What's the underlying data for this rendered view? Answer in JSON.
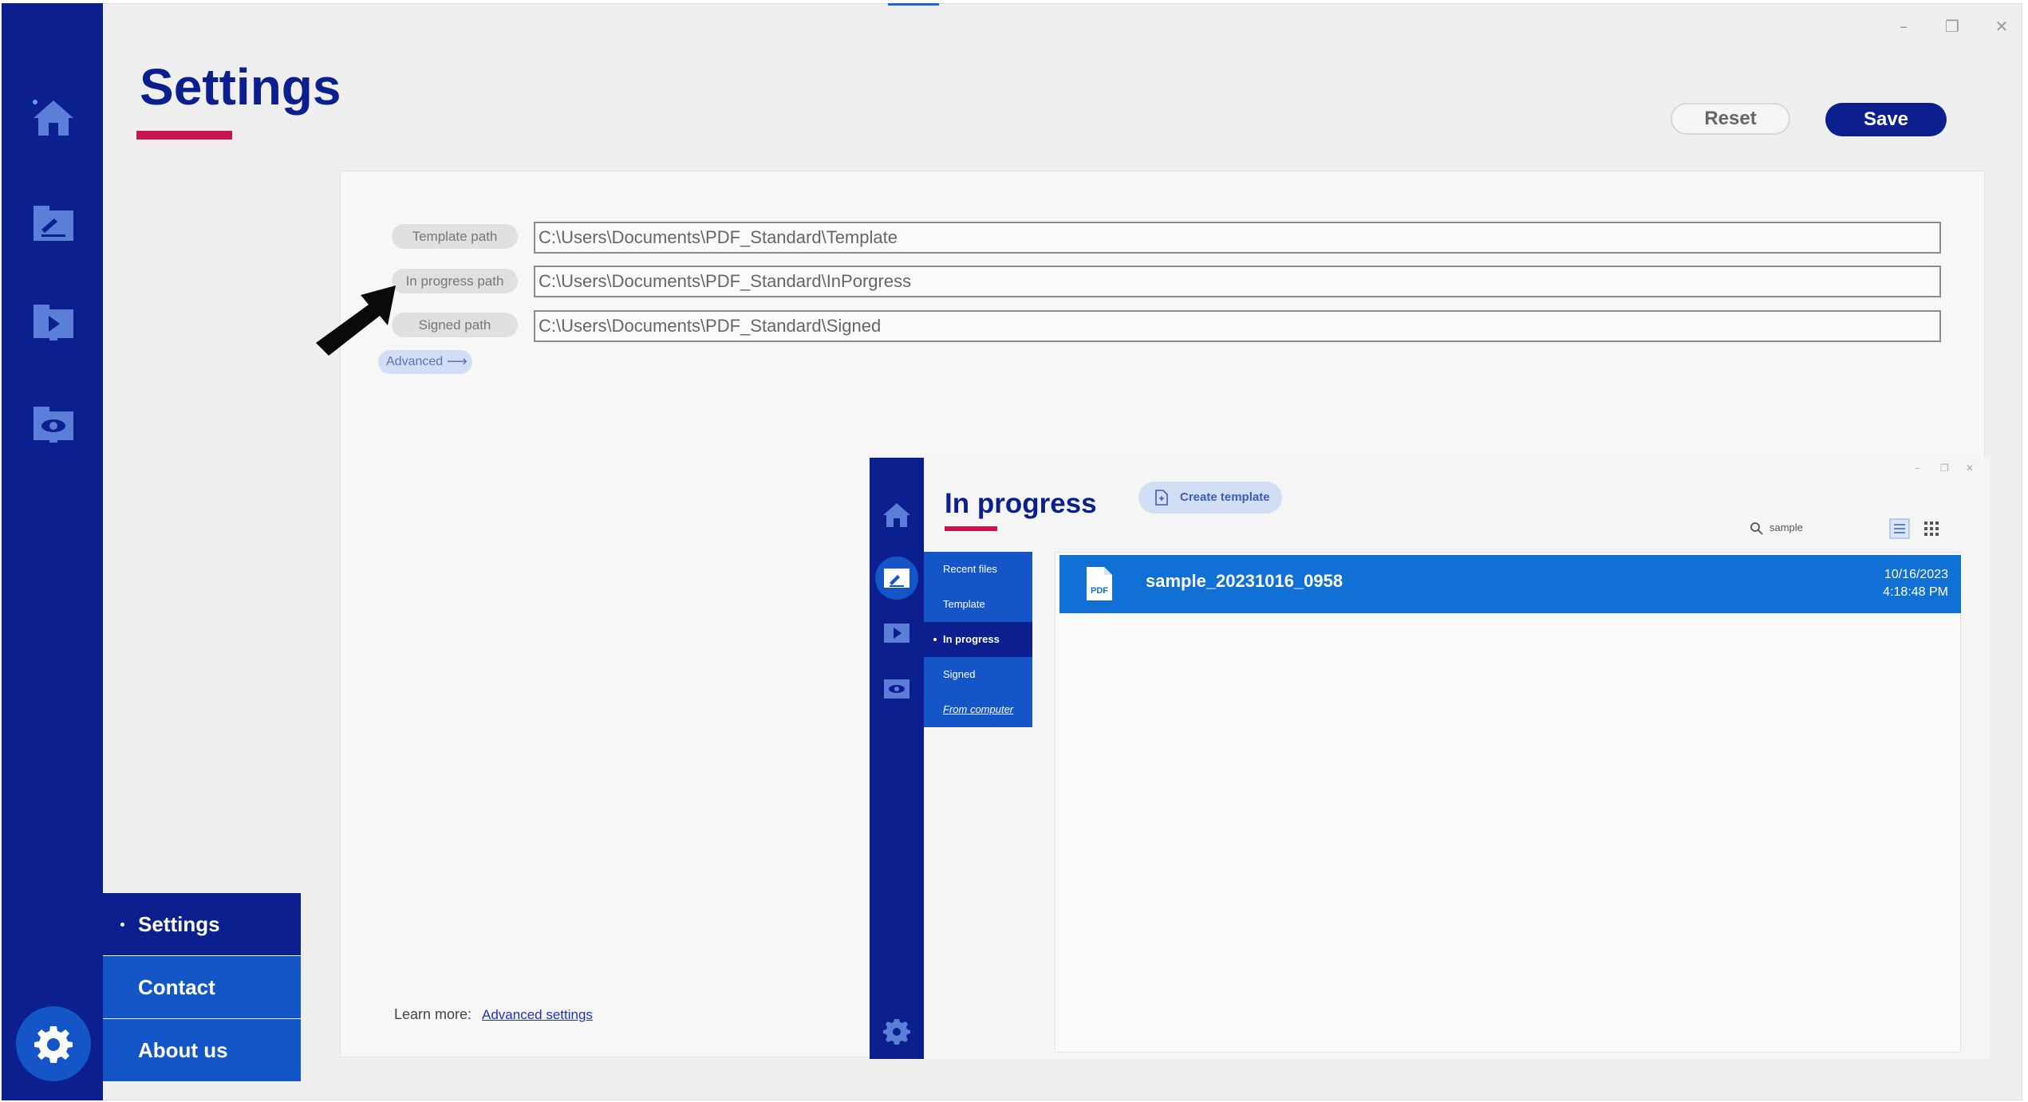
{
  "window": {
    "controls": [
      "–",
      "❐",
      "✕"
    ]
  },
  "header": {
    "title": "Settings",
    "reset_label": "Reset",
    "save_label": "Save"
  },
  "paths": [
    {
      "label": "Template path",
      "value": "C:\\Users\\Documents\\PDF_Standard\\Template"
    },
    {
      "label": "In progress path",
      "value": "C:\\Users\\Documents\\PDF_Standard\\InPorgress"
    },
    {
      "label": "Signed path",
      "value": "C:\\Users\\Documents\\PDF_Standard\\Signed"
    }
  ],
  "advanced_label": "Advanced",
  "learn_more": {
    "label": "Learn more:",
    "link": "Advanced settings"
  },
  "bottom_nav": [
    {
      "label": "Settings",
      "active": true
    },
    {
      "label": "Contact",
      "active": false
    },
    {
      "label": "About us",
      "active": false
    }
  ],
  "sidebar_icons": [
    "home-icon",
    "sign-document-icon",
    "video-icon",
    "eye-icon",
    "gear-icon"
  ],
  "colors": {
    "navy": "#0b1f8f",
    "blue": "#1455c7",
    "accent": "#c8174f",
    "row_blue": "#1170d6"
  },
  "preview": {
    "title": "In progress",
    "create_template_label": "Create template",
    "search_value": "sample",
    "submenu": [
      "Recent files",
      "Template",
      "In progress",
      "Signed",
      "From computer"
    ],
    "file": {
      "icon_text": "PDF",
      "name": "sample_20231016_0958",
      "date": "10/16/2023",
      "time": "4:18:48 PM"
    }
  }
}
